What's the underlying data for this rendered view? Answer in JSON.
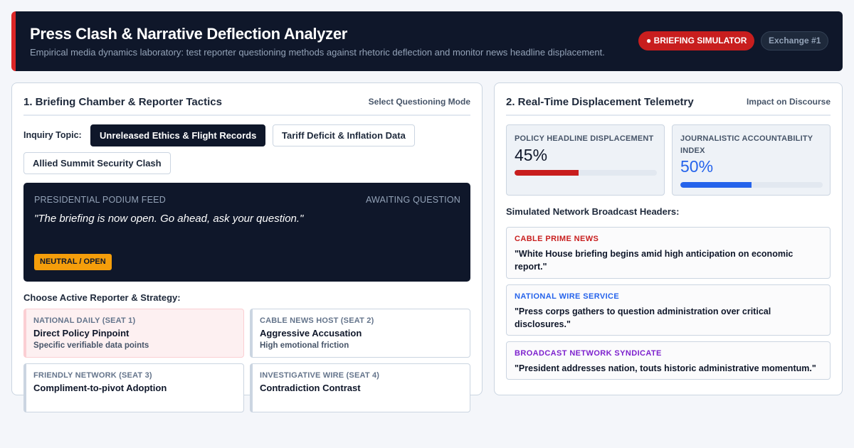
{
  "app": {
    "title": "Press Clash & Narrative Deflection Analyzer",
    "subtitle": "Empirical media dynamics laboratory: test reporter questioning methods against rhetoric deflection and monitor news headline displacement.",
    "live_badge": "● BRIEFING SIMULATOR",
    "exchange_badge": "Exchange #1"
  },
  "left_panel": {
    "title": "1. Briefing Chamber & Reporter Tactics",
    "meta": "Select Questioning Mode",
    "topic_label": "Inquiry Topic:",
    "topics": [
      {
        "label": "Unreleased Ethics & Flight Records",
        "active": true
      },
      {
        "label": "Tariff Deficit & Inflation Data",
        "active": false
      },
      {
        "label": "Allied Summit Security Clash",
        "active": false
      }
    ],
    "podium": {
      "feed_label": "PRESIDENTIAL PODIUM FEED",
      "state": "AWAITING QUESTION",
      "quote": "\"The briefing is now open. Go ahead, ask your question.\"",
      "tone": "NEUTRAL / OPEN"
    },
    "reporter_label": "Choose Active Reporter & Strategy:",
    "reporters": [
      {
        "seat": "NATIONAL DAILY (SEAT 1)",
        "strategy": "Direct Policy Pinpoint",
        "desc": "Specific verifiable data points",
        "selected": true
      },
      {
        "seat": "CABLE NEWS HOST (SEAT 2)",
        "strategy": "Aggressive Accusation",
        "desc": "High emotional friction",
        "selected": false
      },
      {
        "seat": "FRIENDLY NETWORK (SEAT 3)",
        "strategy": "Compliment-to-pivot Adoption",
        "desc": "",
        "selected": false
      },
      {
        "seat": "INVESTIGATIVE WIRE (SEAT 4)",
        "strategy": "Contradiction Contrast",
        "desc": "",
        "selected": false
      }
    ]
  },
  "right_panel": {
    "title": "2. Real-Time Displacement Telemetry",
    "meta": "Impact on Discourse",
    "metrics": [
      {
        "label": "POLICY HEADLINE DISPLACEMENT",
        "value": "45%",
        "percent": 45,
        "color": "#c81e1e",
        "value_color": "#0f172a"
      },
      {
        "label": "JOURNALISTIC ACCOUNTABILITY INDEX",
        "value": "50%",
        "percent": 50,
        "color": "#2563eb",
        "value_color": "#2563eb"
      }
    ],
    "broadcast_label": "Simulated Network Broadcast Headers:",
    "broadcasts": [
      {
        "network": "CABLE PRIME NEWS",
        "color": "#c81e1e",
        "headline": "\"White House briefing begins amid high anticipation on economic report.\""
      },
      {
        "network": "NATIONAL WIRE SERVICE",
        "color": "#2563eb",
        "headline": "\"Press corps gathers to question administration over critical disclosures.\""
      },
      {
        "network": "BROADCAST NETWORK SYNDICATE",
        "color": "#7e22ce",
        "headline": "\"President addresses nation, touts historic administrative momentum.\""
      }
    ]
  }
}
